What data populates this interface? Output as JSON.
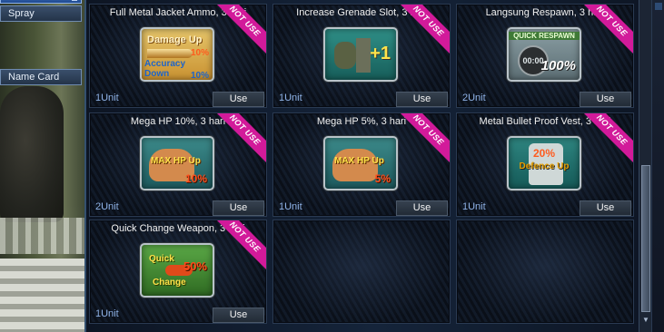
{
  "left_menu": {
    "items": [
      {
        "label": "Spray"
      },
      {
        "label": "Name Card"
      }
    ]
  },
  "inventory": {
    "tag_text": "NOT USE",
    "use_label": "Use",
    "slots": [
      {
        "title": "Full Metal Jacket Ammo, 3 hari",
        "unit": "1Unit",
        "icon": "ammo-icon",
        "icon_text": {
          "line1": "Damage Up",
          "line2": "10%",
          "line3": "Accuracy Down",
          "line4": "10%"
        }
      },
      {
        "title": "Increase Grenade Slot, 3 hari",
        "unit": "1Unit",
        "icon": "grenade-icon",
        "icon_text": {
          "line1": "+1"
        }
      },
      {
        "title": "Langsung Respawn, 3 hari",
        "unit": "2Unit",
        "icon": "respawn-icon",
        "icon_text": {
          "line1": "QUICK RESPAWN",
          "line2": "00:00",
          "line3": "100%"
        }
      },
      {
        "title": "Mega HP 10%, 3 hari",
        "unit": "2Unit",
        "icon": "mega-hp-10-icon",
        "icon_text": {
          "line1": "MAX HP Up",
          "line2": "10%"
        }
      },
      {
        "title": "Mega HP 5%, 3 hari",
        "unit": "1Unit",
        "icon": "mega-hp-5-icon",
        "icon_text": {
          "line1": "MAX HP Up",
          "line2": "5%"
        }
      },
      {
        "title": "Metal Bullet Proof Vest, 3 hari",
        "unit": "1Unit",
        "icon": "vest-icon",
        "icon_text": {
          "line1": "20%",
          "line2": "Defence Up"
        }
      },
      {
        "title": "Quick Change Weapon, 3 hari",
        "unit": "1Unit",
        "icon": "quick-change-icon",
        "icon_text": {
          "line1": "Quick",
          "line2": "Change",
          "line3": "50%"
        }
      }
    ]
  },
  "colors": {
    "tag": "#d21a9a",
    "unit_text": "#8fb2e6",
    "panel_border": "#2a3a52"
  }
}
